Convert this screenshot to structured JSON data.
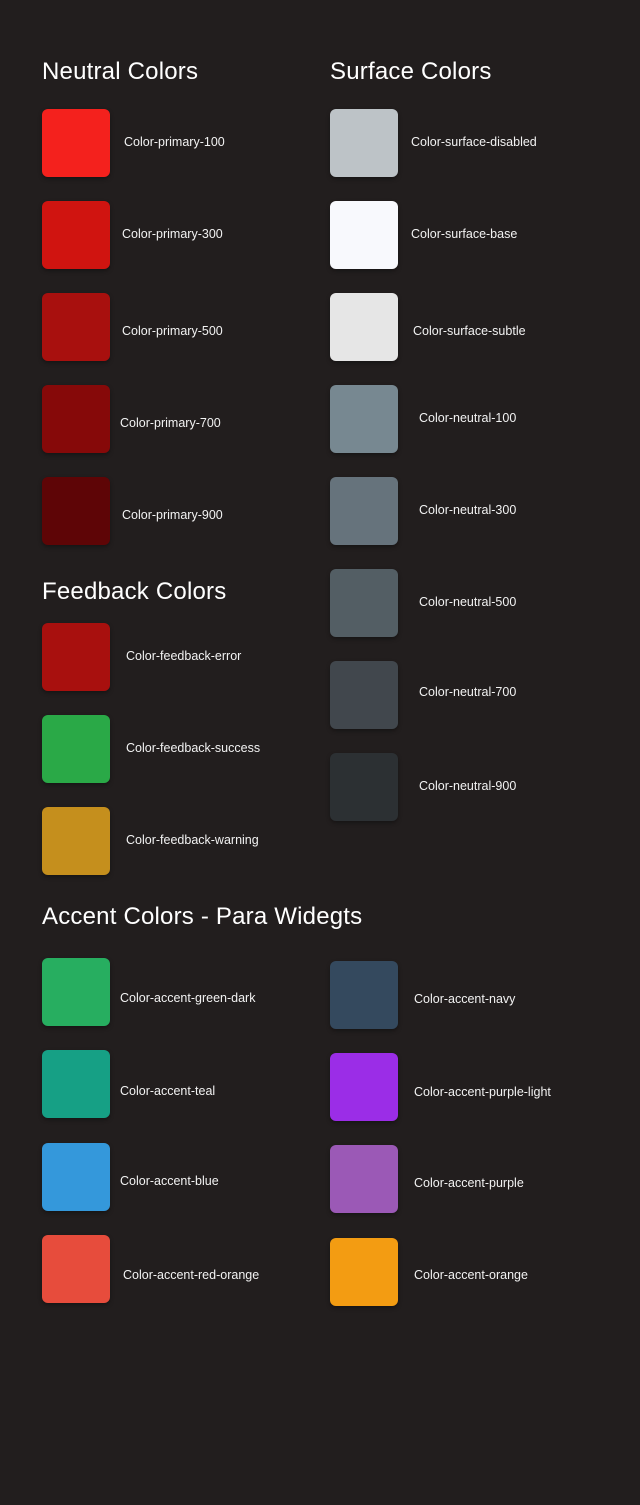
{
  "sections": {
    "neutral": {
      "title": "Neutral Colors",
      "items": [
        {
          "label": "Color-primary-100",
          "color": "#f4211d"
        },
        {
          "label": "Color-primary-300",
          "color": "#d01410"
        },
        {
          "label": "Color-primary-500",
          "color": "#a8100e"
        },
        {
          "label": "Color-primary-700",
          "color": "#860909"
        },
        {
          "label": "Color-primary-900",
          "color": "#5e0506"
        }
      ]
    },
    "surface": {
      "title": "Surface Colors",
      "items": [
        {
          "label": "Color-surface-disabled",
          "color": "#bdc3c7"
        },
        {
          "label": "Color-surface-base",
          "color": "#f8f9fd"
        },
        {
          "label": "Color-surface-subtle",
          "color": "#e6e6e6"
        },
        {
          "label": "Color-neutral-100",
          "color": "#778891"
        },
        {
          "label": "Color-neutral-300",
          "color": "#66737c"
        },
        {
          "label": "Color-neutral-500",
          "color": "#535e64"
        },
        {
          "label": "Color-neutral-700",
          "color": "#41474d"
        },
        {
          "label": "Color-neutral-900",
          "color": "#2c3033"
        }
      ]
    },
    "feedback": {
      "title": "Feedback Colors",
      "items": [
        {
          "label": "Color-feedback-error",
          "color": "#a8100e"
        },
        {
          "label": "Color-feedback-success",
          "color": "#2aa947"
        },
        {
          "label": "Color-feedback-warning",
          "color": "#c58f1d"
        }
      ]
    },
    "accent": {
      "title": "Accent Colors - Para Widegts",
      "left_items": [
        {
          "label": "Color-accent-green-dark",
          "color": "#27ae60"
        },
        {
          "label": "Color-accent-teal",
          "color": "#16a085"
        },
        {
          "label": "Color-accent-blue",
          "color": "#3498db"
        },
        {
          "label": "Color-accent-red-orange",
          "color": "#e74c3c"
        }
      ],
      "right_items": [
        {
          "label": "Color-accent-navy",
          "color": "#34495e"
        },
        {
          "label": "Color-accent-purple-light",
          "color": "#9b2de7"
        },
        {
          "label": "Color-accent-purple",
          "color": "#9b59b6"
        },
        {
          "label": "Color-accent-orange",
          "color": "#f39c12"
        }
      ]
    }
  }
}
